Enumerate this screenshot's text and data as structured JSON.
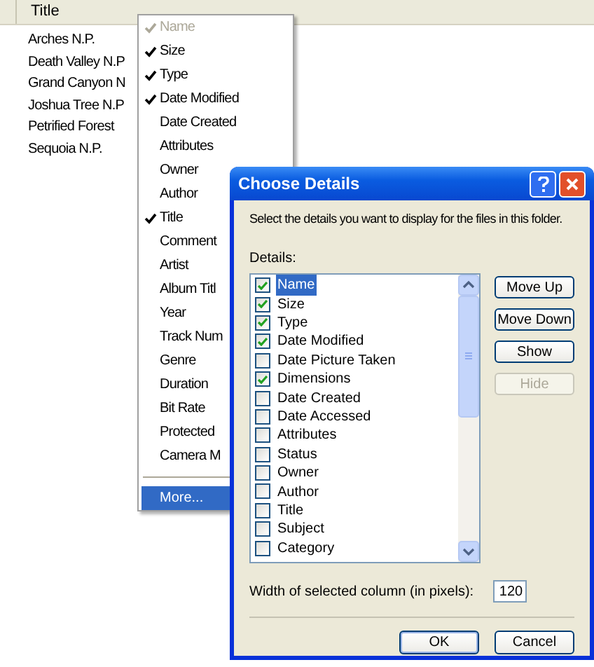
{
  "header": {
    "column": "Title"
  },
  "files": [
    "Arches N.P.",
    "Death Valley N.P",
    "Grand Canyon N",
    "Joshua Tree N.P",
    "Petrified Forest",
    "Sequoia N.P."
  ],
  "context_menu": {
    "items": [
      {
        "label": "Name",
        "checked": true,
        "disabled": true,
        "selected": false
      },
      {
        "label": "Size",
        "checked": true,
        "disabled": false,
        "selected": false
      },
      {
        "label": "Type",
        "checked": true,
        "disabled": false,
        "selected": false
      },
      {
        "label": "Date Modified",
        "checked": true,
        "disabled": false,
        "selected": false
      },
      {
        "label": "Date Created",
        "checked": false,
        "disabled": false,
        "selected": false
      },
      {
        "label": "Attributes",
        "checked": false,
        "disabled": false,
        "selected": false
      },
      {
        "label": "Owner",
        "checked": false,
        "disabled": false,
        "selected": false
      },
      {
        "label": "Author",
        "checked": false,
        "disabled": false,
        "selected": false
      },
      {
        "label": "Title",
        "checked": true,
        "disabled": false,
        "selected": false
      },
      {
        "label": "Comment",
        "checked": false,
        "disabled": false,
        "selected": false
      },
      {
        "label": "Artist",
        "checked": false,
        "disabled": false,
        "selected": false
      },
      {
        "label": "Album Titl",
        "checked": false,
        "disabled": false,
        "selected": false
      },
      {
        "label": "Year",
        "checked": false,
        "disabled": false,
        "selected": false
      },
      {
        "label": "Track Num",
        "checked": false,
        "disabled": false,
        "selected": false
      },
      {
        "label": "Genre",
        "checked": false,
        "disabled": false,
        "selected": false
      },
      {
        "label": "Duration",
        "checked": false,
        "disabled": false,
        "selected": false
      },
      {
        "label": "Bit Rate",
        "checked": false,
        "disabled": false,
        "selected": false
      },
      {
        "label": "Protected",
        "checked": false,
        "disabled": false,
        "selected": false
      },
      {
        "label": "Camera M",
        "checked": false,
        "disabled": false,
        "selected": false
      }
    ],
    "more": {
      "label": "More...",
      "selected": true
    }
  },
  "dialog": {
    "title": "Choose Details",
    "instruction": "Select the details you want to display for the files in this folder.",
    "details_label": "Details:",
    "details": [
      {
        "label": "Name",
        "checked": true,
        "selected": true
      },
      {
        "label": "Size",
        "checked": true,
        "selected": false
      },
      {
        "label": "Type",
        "checked": true,
        "selected": false
      },
      {
        "label": "Date Modified",
        "checked": true,
        "selected": false
      },
      {
        "label": "Date Picture Taken",
        "checked": false,
        "selected": false
      },
      {
        "label": "Dimensions",
        "checked": true,
        "selected": false
      },
      {
        "label": "Date Created",
        "checked": false,
        "selected": false
      },
      {
        "label": "Date Accessed",
        "checked": false,
        "selected": false
      },
      {
        "label": "Attributes",
        "checked": false,
        "selected": false
      },
      {
        "label": "Status",
        "checked": false,
        "selected": false
      },
      {
        "label": "Owner",
        "checked": false,
        "selected": false
      },
      {
        "label": "Author",
        "checked": false,
        "selected": false
      },
      {
        "label": "Title",
        "checked": false,
        "selected": false
      },
      {
        "label": "Subject",
        "checked": false,
        "selected": false
      },
      {
        "label": "Category",
        "checked": false,
        "selected": false
      }
    ],
    "side_buttons": [
      {
        "label": "Move Up",
        "disabled": false
      },
      {
        "label": "Move Down",
        "disabled": false
      },
      {
        "label": "Show",
        "disabled": false
      },
      {
        "label": "Hide",
        "disabled": true
      }
    ],
    "width_label": "Width of selected column (in pixels):",
    "width_value": "120",
    "ok": "OK",
    "cancel": "Cancel"
  }
}
